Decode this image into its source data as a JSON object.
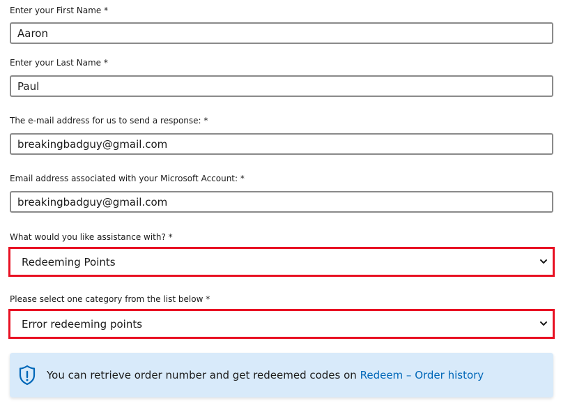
{
  "form": {
    "first_name": {
      "label": "Enter your First Name *",
      "value": "Aaron"
    },
    "last_name": {
      "label": "Enter your Last Name *",
      "value": "Paul"
    },
    "response_email": {
      "label": "The e-mail address for us to send a response: *",
      "value": "breakingbadguy@gmail.com"
    },
    "account_email": {
      "label": "Email address associated with your Microsoft Account: *",
      "value": "breakingbadguy@gmail.com"
    },
    "assistance": {
      "label": "What would you like assistance with? *",
      "selected": "Redeeming Points"
    },
    "category": {
      "label": "Please select one category from the list below *",
      "selected": "Error redeeming points"
    }
  },
  "info_banner": {
    "text": "You can retrieve order number and get redeemed codes on",
    "link_text": "Redeem – Order history",
    "icon": "shield-info-icon"
  },
  "colors": {
    "highlight_border": "#e81123",
    "input_border": "#8a8a8a",
    "banner_bg": "#d8eafa",
    "link": "#0067b8"
  }
}
